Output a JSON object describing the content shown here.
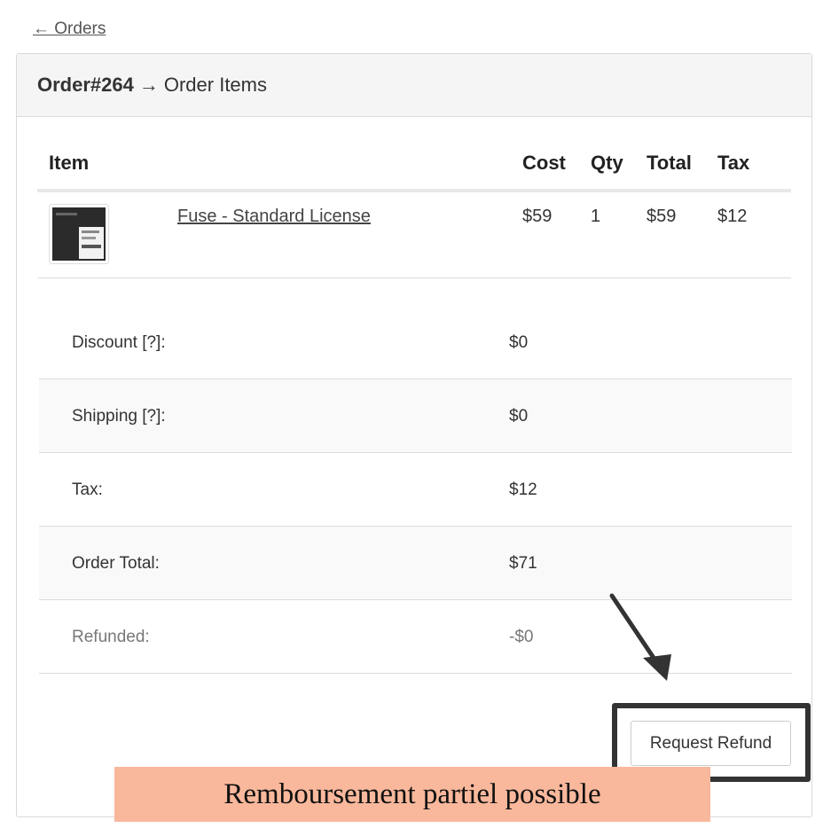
{
  "nav": {
    "back_label": "← Orders"
  },
  "header": {
    "order_number": "Order#264",
    "arrow": "→",
    "section": "Order Items"
  },
  "items_table": {
    "columns": [
      "Item",
      "Cost",
      "Qty",
      "Total",
      "Tax"
    ],
    "rows": [
      {
        "name": "Fuse - Standard License",
        "cost": "$59",
        "qty": "1",
        "total": "$59",
        "tax": "$12"
      }
    ]
  },
  "summary": [
    {
      "label": "Discount [?]:",
      "value": "$0"
    },
    {
      "label": "Shipping [?]:",
      "value": "$0"
    },
    {
      "label": "Tax:",
      "value": "$12"
    },
    {
      "label": "Order Total:",
      "value": "$71"
    },
    {
      "label": "Refunded:",
      "value": "-$0"
    }
  ],
  "actions": {
    "request_refund_label": "Request Refund"
  },
  "annotation": {
    "caption": "Remboursement partiel possible",
    "highlight_color": "#333333",
    "caption_bg": "#f9b89c"
  }
}
